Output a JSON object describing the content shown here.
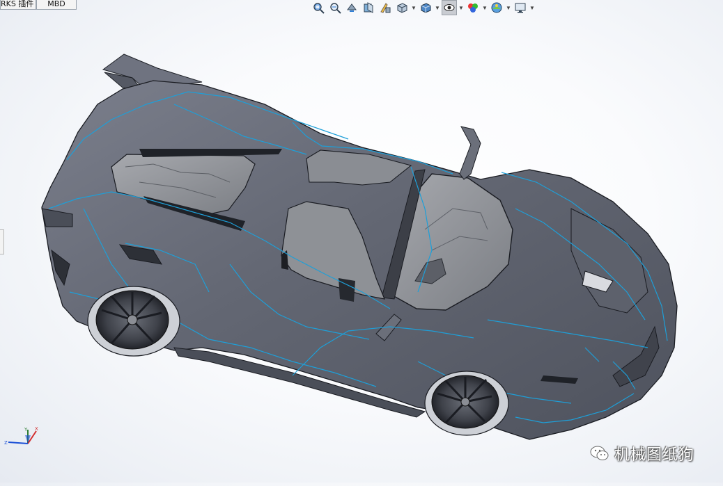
{
  "command_tabs": [
    {
      "label": "RKS 插件"
    },
    {
      "label": "MBD"
    }
  ],
  "heads_up_toolbar": {
    "items": [
      {
        "icon": "zoom-to-fit-icon"
      },
      {
        "icon": "zoom-to-area-icon"
      },
      {
        "icon": "previous-view-icon"
      },
      {
        "icon": "section-view-icon"
      },
      {
        "icon": "dynamic-annotation-view-icon"
      },
      {
        "icon": "view-orientation-icon"
      },
      {
        "icon": "display-style-icon"
      },
      {
        "icon": "hide-show-items-icon"
      },
      {
        "icon": "edit-appearance-icon"
      },
      {
        "icon": "apply-scene-icon"
      },
      {
        "icon": "view-settings-icon"
      }
    ]
  },
  "model": {
    "description_icon": "supercar-3d-model"
  },
  "triad": {
    "x_label": "X",
    "y_label": "Y",
    "z_label": "Z"
  },
  "watermark": {
    "text": "机械图纸狗",
    "icon": "wechat-icon"
  }
}
